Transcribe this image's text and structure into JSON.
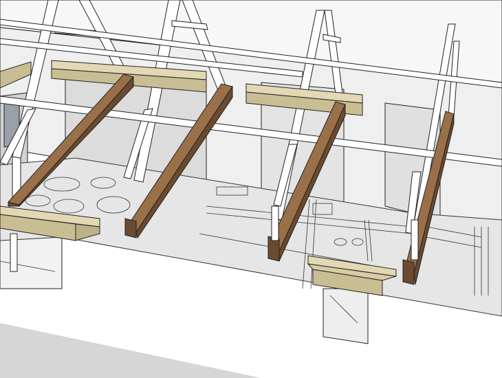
{
  "view": {
    "type": "3d-roof-structure-model",
    "style": "hidden-line-shaded",
    "colors": {
      "background": "#ffffff",
      "ground": "#d4d4d4",
      "floor": "#e6e6e6",
      "wall": "#f4f4f4",
      "wall_shade": "#d8d8d8",
      "edge": "#1a1a1a",
      "brown_beam_side": "#6b4a2f",
      "brown_beam_top": "#9a7048",
      "tan_beam_side": "#c9bd94",
      "tan_beam_top": "#e2d8b4",
      "truss_member": "#ffffff"
    }
  },
  "components": {
    "trusses": 4,
    "purlins": 3,
    "floor_beams": 4,
    "bearer_blocks": 5
  }
}
